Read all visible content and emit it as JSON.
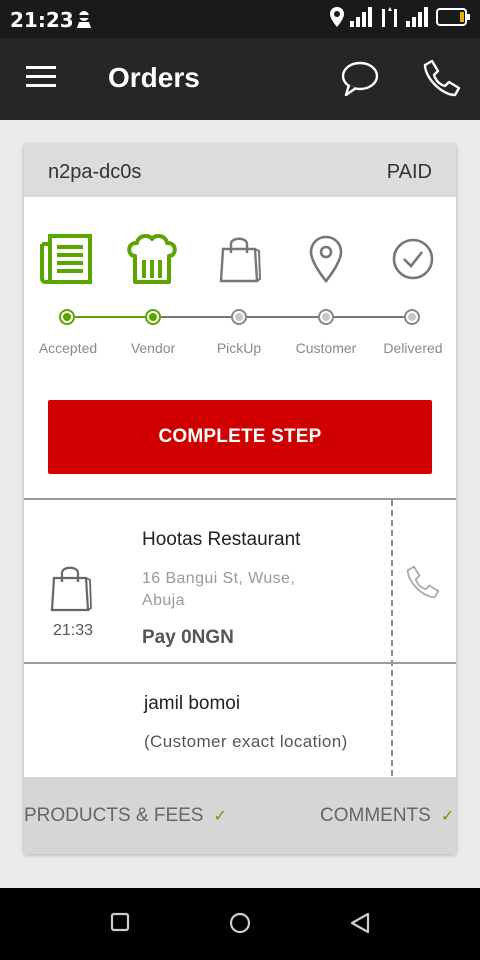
{
  "status_bar": {
    "time": "21:23",
    "icons": [
      "ninja-icon",
      "location-icon",
      "signal-icon",
      "network-4g-icon",
      "signal-icon",
      "battery-icon"
    ]
  },
  "app_bar": {
    "title": "Orders",
    "icons": [
      "menu-icon",
      "chat-icon",
      "phone-icon"
    ]
  },
  "order": {
    "id": "n2pa-dc0s",
    "payment_status": "PAID",
    "steps": [
      {
        "label": "Accepted",
        "icon": "list-icon",
        "done": true
      },
      {
        "label": "Vendor",
        "icon": "chef-hat-icon",
        "done": true
      },
      {
        "label": "PickUp",
        "icon": "shopping-bag-icon",
        "done": false
      },
      {
        "label": "Customer",
        "icon": "location-pin-icon",
        "done": false
      },
      {
        "label": "Delivered",
        "icon": "check-circle-icon",
        "done": false
      }
    ],
    "complete_button": "COMPLETE STEP",
    "pickup": {
      "time": "21:33",
      "restaurant": "Hootas Restaurant",
      "address": "16 Bangui St, Wuse, Abuja",
      "payment": "Pay 0NGN"
    },
    "customer": {
      "name": "jamil bomoi",
      "location": "(Customer exact location)"
    },
    "tabs": [
      {
        "label": "PRODUCTS & FEES",
        "check": "✓"
      },
      {
        "label": "COMMENTS",
        "check": "✓"
      }
    ]
  },
  "colors": {
    "accent_green": "#5aa500",
    "primary_red": "#d10000",
    "dark_bar": "#262626"
  }
}
